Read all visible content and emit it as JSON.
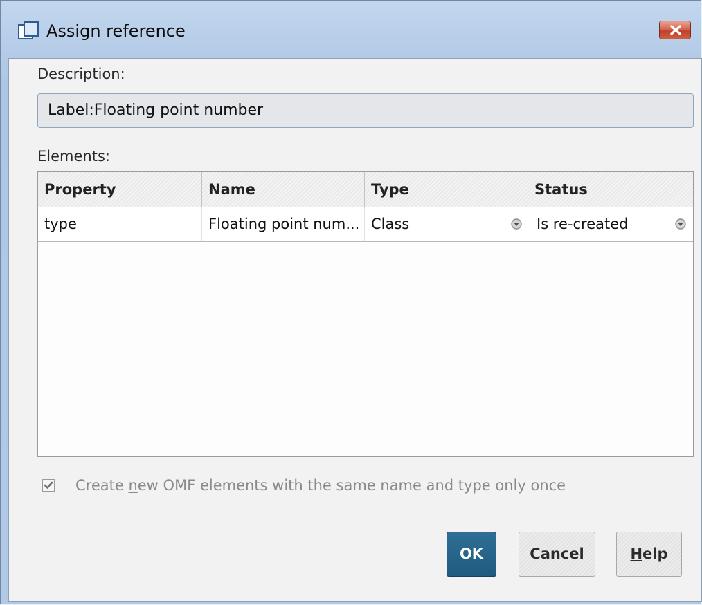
{
  "window": {
    "title": "Assign reference",
    "title_icon": "dialog-window-icon",
    "close_icon": "close-icon"
  },
  "description": {
    "label": "Description:",
    "value": "Label:Floating point number"
  },
  "elements": {
    "label": "Elements:",
    "columns": [
      "Property",
      "Name",
      "Type",
      "Status"
    ],
    "rows": [
      {
        "property": "type",
        "name": "Floating point num...",
        "type": "Class",
        "status": "Is re-created"
      }
    ]
  },
  "options": {
    "create_once": {
      "label_before": "Create ",
      "label_mnemonic": "n",
      "label_after": "ew OMF elements with the same name and type only once",
      "checked": true
    }
  },
  "buttons": {
    "ok": "OK",
    "cancel": "Cancel",
    "help_mnemonic": "H",
    "help_rest": "elp"
  },
  "colors": {
    "accent": "#205a80",
    "close": "#c94a30"
  }
}
